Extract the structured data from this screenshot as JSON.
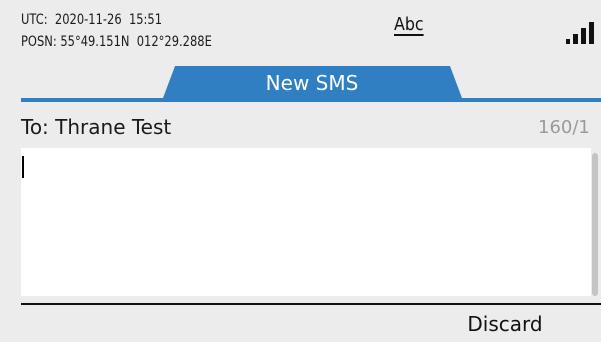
{
  "status": {
    "utc_text": "UTC:  2020-11-26  15:51",
    "posn_text": "POSN: 55°49.151N  012°29.288E",
    "input_mode": "Abc",
    "signal_icon": "signal-strength-icon"
  },
  "header": {
    "title": "New SMS",
    "accent_color": "#2f7fc2"
  },
  "message": {
    "recipient": "To: Thrane Test",
    "char_count": "160/1",
    "body": ""
  },
  "softkeys": {
    "discard_label": "Discard"
  }
}
